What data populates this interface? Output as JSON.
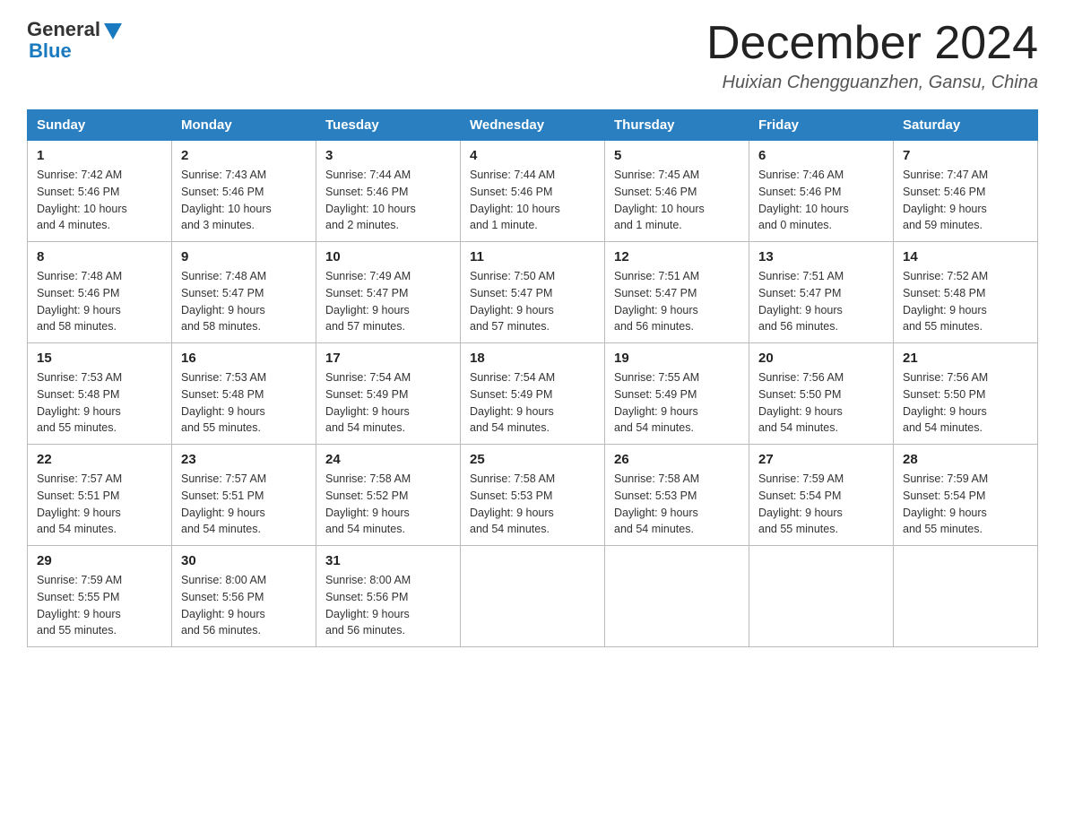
{
  "header": {
    "logo_general": "General",
    "logo_blue": "Blue",
    "month_title": "December 2024",
    "location": "Huixian Chengguanzhen, Gansu, China"
  },
  "weekdays": [
    "Sunday",
    "Monday",
    "Tuesday",
    "Wednesday",
    "Thursday",
    "Friday",
    "Saturday"
  ],
  "weeks": [
    [
      {
        "day": "1",
        "info": "Sunrise: 7:42 AM\nSunset: 5:46 PM\nDaylight: 10 hours\nand 4 minutes."
      },
      {
        "day": "2",
        "info": "Sunrise: 7:43 AM\nSunset: 5:46 PM\nDaylight: 10 hours\nand 3 minutes."
      },
      {
        "day": "3",
        "info": "Sunrise: 7:44 AM\nSunset: 5:46 PM\nDaylight: 10 hours\nand 2 minutes."
      },
      {
        "day": "4",
        "info": "Sunrise: 7:44 AM\nSunset: 5:46 PM\nDaylight: 10 hours\nand 1 minute."
      },
      {
        "day": "5",
        "info": "Sunrise: 7:45 AM\nSunset: 5:46 PM\nDaylight: 10 hours\nand 1 minute."
      },
      {
        "day": "6",
        "info": "Sunrise: 7:46 AM\nSunset: 5:46 PM\nDaylight: 10 hours\nand 0 minutes."
      },
      {
        "day": "7",
        "info": "Sunrise: 7:47 AM\nSunset: 5:46 PM\nDaylight: 9 hours\nand 59 minutes."
      }
    ],
    [
      {
        "day": "8",
        "info": "Sunrise: 7:48 AM\nSunset: 5:46 PM\nDaylight: 9 hours\nand 58 minutes."
      },
      {
        "day": "9",
        "info": "Sunrise: 7:48 AM\nSunset: 5:47 PM\nDaylight: 9 hours\nand 58 minutes."
      },
      {
        "day": "10",
        "info": "Sunrise: 7:49 AM\nSunset: 5:47 PM\nDaylight: 9 hours\nand 57 minutes."
      },
      {
        "day": "11",
        "info": "Sunrise: 7:50 AM\nSunset: 5:47 PM\nDaylight: 9 hours\nand 57 minutes."
      },
      {
        "day": "12",
        "info": "Sunrise: 7:51 AM\nSunset: 5:47 PM\nDaylight: 9 hours\nand 56 minutes."
      },
      {
        "day": "13",
        "info": "Sunrise: 7:51 AM\nSunset: 5:47 PM\nDaylight: 9 hours\nand 56 minutes."
      },
      {
        "day": "14",
        "info": "Sunrise: 7:52 AM\nSunset: 5:48 PM\nDaylight: 9 hours\nand 55 minutes."
      }
    ],
    [
      {
        "day": "15",
        "info": "Sunrise: 7:53 AM\nSunset: 5:48 PM\nDaylight: 9 hours\nand 55 minutes."
      },
      {
        "day": "16",
        "info": "Sunrise: 7:53 AM\nSunset: 5:48 PM\nDaylight: 9 hours\nand 55 minutes."
      },
      {
        "day": "17",
        "info": "Sunrise: 7:54 AM\nSunset: 5:49 PM\nDaylight: 9 hours\nand 54 minutes."
      },
      {
        "day": "18",
        "info": "Sunrise: 7:54 AM\nSunset: 5:49 PM\nDaylight: 9 hours\nand 54 minutes."
      },
      {
        "day": "19",
        "info": "Sunrise: 7:55 AM\nSunset: 5:49 PM\nDaylight: 9 hours\nand 54 minutes."
      },
      {
        "day": "20",
        "info": "Sunrise: 7:56 AM\nSunset: 5:50 PM\nDaylight: 9 hours\nand 54 minutes."
      },
      {
        "day": "21",
        "info": "Sunrise: 7:56 AM\nSunset: 5:50 PM\nDaylight: 9 hours\nand 54 minutes."
      }
    ],
    [
      {
        "day": "22",
        "info": "Sunrise: 7:57 AM\nSunset: 5:51 PM\nDaylight: 9 hours\nand 54 minutes."
      },
      {
        "day": "23",
        "info": "Sunrise: 7:57 AM\nSunset: 5:51 PM\nDaylight: 9 hours\nand 54 minutes."
      },
      {
        "day": "24",
        "info": "Sunrise: 7:58 AM\nSunset: 5:52 PM\nDaylight: 9 hours\nand 54 minutes."
      },
      {
        "day": "25",
        "info": "Sunrise: 7:58 AM\nSunset: 5:53 PM\nDaylight: 9 hours\nand 54 minutes."
      },
      {
        "day": "26",
        "info": "Sunrise: 7:58 AM\nSunset: 5:53 PM\nDaylight: 9 hours\nand 54 minutes."
      },
      {
        "day": "27",
        "info": "Sunrise: 7:59 AM\nSunset: 5:54 PM\nDaylight: 9 hours\nand 55 minutes."
      },
      {
        "day": "28",
        "info": "Sunrise: 7:59 AM\nSunset: 5:54 PM\nDaylight: 9 hours\nand 55 minutes."
      }
    ],
    [
      {
        "day": "29",
        "info": "Sunrise: 7:59 AM\nSunset: 5:55 PM\nDaylight: 9 hours\nand 55 minutes."
      },
      {
        "day": "30",
        "info": "Sunrise: 8:00 AM\nSunset: 5:56 PM\nDaylight: 9 hours\nand 56 minutes."
      },
      {
        "day": "31",
        "info": "Sunrise: 8:00 AM\nSunset: 5:56 PM\nDaylight: 9 hours\nand 56 minutes."
      },
      {
        "day": "",
        "info": ""
      },
      {
        "day": "",
        "info": ""
      },
      {
        "day": "",
        "info": ""
      },
      {
        "day": "",
        "info": ""
      }
    ]
  ]
}
